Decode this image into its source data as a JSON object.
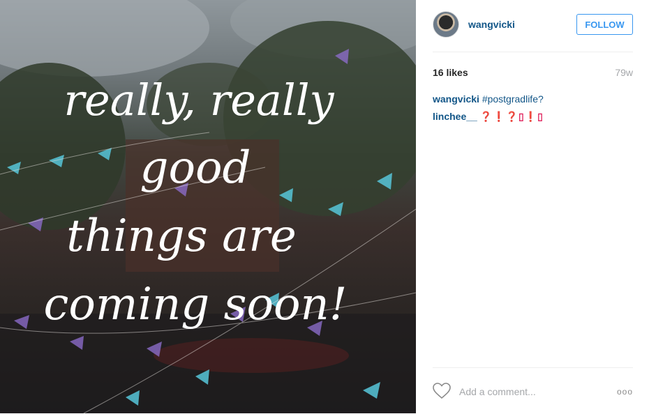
{
  "post": {
    "username": "wangvicki",
    "follow_label": "FOLLOW",
    "likes": "16 likes",
    "age": "79w",
    "caption_user": "wangvicki",
    "caption_text": "#postgradlife?",
    "comment_user": "linchee__",
    "comment_text": "❓❗❓▯❗▯",
    "add_comment_placeholder": "Add a comment...",
    "more_label": "ooo"
  },
  "photo": {
    "handwriting": [
      "really, really",
      "good",
      "things are",
      "coming soon!"
    ]
  },
  "icons": [
    "heart-icon",
    "more-options-icon"
  ],
  "colors": {
    "link": "#125688",
    "follow": "#3897f0",
    "muted": "#a5a7aa"
  }
}
